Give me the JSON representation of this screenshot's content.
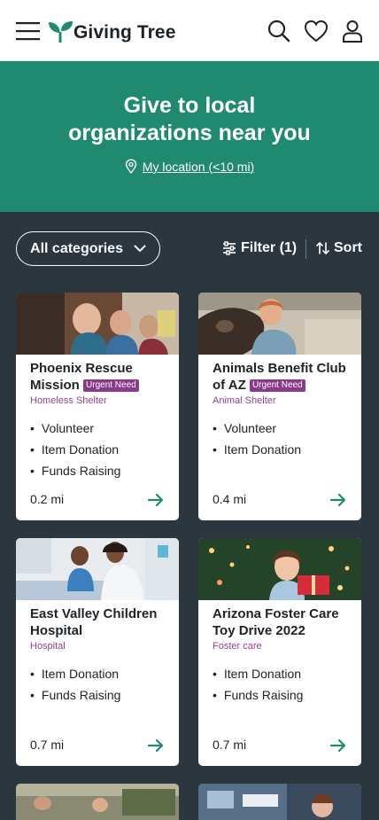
{
  "header": {
    "brand": "Giving Tree",
    "icons": [
      "menu-icon",
      "search-icon",
      "heart-icon",
      "user-icon"
    ],
    "brand_color": "#1f8a70"
  },
  "hero": {
    "title_line1": "Give to local",
    "title_line2": "organizations near you",
    "location_link": "My location (<10 mi)"
  },
  "controls": {
    "category_label": "All categories",
    "filter_label": "Filter (1)",
    "sort_label": "Sort"
  },
  "cards": [
    {
      "title": "Phoenix Rescue Mission",
      "badge": "Urgent Need",
      "category": "Homeless Shelter",
      "items": [
        "Volunteer",
        "Item Donation",
        "Funds Raising"
      ],
      "distance": "0.2 mi"
    },
    {
      "title": "Animals Benefit Club of AZ",
      "badge": "Urgent Need",
      "category": "Animal Shelter",
      "items": [
        "Volunteer",
        "Item Donation"
      ],
      "distance": "0.4 mi"
    },
    {
      "title": "East Valley Children Hospital",
      "badge": "",
      "category": "Hospital",
      "items": [
        "Item Donation",
        "Funds Raising"
      ],
      "distance": "0.7 mi"
    },
    {
      "title": "Arizona Foster Care Toy Drive 2022",
      "badge": "",
      "category": "Foster care",
      "items": [
        "Item Donation",
        "Funds Raising"
      ],
      "distance": "0.7 mi"
    }
  ],
  "colors": {
    "background": "#2c363f",
    "accent": "#1f8a70",
    "badge": "#8a3a8a",
    "category_text": "#9a3f8f"
  }
}
